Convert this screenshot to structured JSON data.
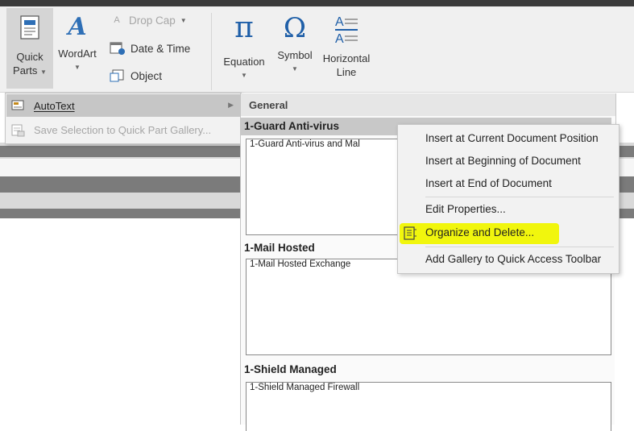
{
  "ribbon": {
    "quick_parts_line1": "Quick",
    "quick_parts_line2": "Parts",
    "wordart": "WordArt",
    "drop_cap": "Drop Cap",
    "date_time": "Date & Time",
    "object": "Object",
    "equation": "Equation",
    "symbol": "Symbol",
    "horizontal_line1": "Horizontal",
    "horizontal_line2": "Line"
  },
  "quick_parts_menu": {
    "autotext": "AutoText",
    "save_selection": "Save Selection to Quick Part Gallery..."
  },
  "gallery": {
    "section": "General",
    "entries": [
      {
        "title": "1-Guard Anti-virus",
        "preview": "1-Guard  Anti-virus and Mal"
      },
      {
        "title": "1-Mail Hosted",
        "preview": "1-Mail Hosted Exchange"
      },
      {
        "title": "1-Shield Managed",
        "preview": "1-Shield Managed  Firewall"
      }
    ]
  },
  "context_menu": {
    "items": [
      "Insert at Current Document Position",
      "Insert at Beginning of Document",
      "Insert at End of Document",
      "Edit Properties...",
      "Organize and Delete...",
      "Add Gallery to Quick Access Toolbar"
    ],
    "highlight_color": "#f0f500"
  },
  "icons": [
    "quick-parts-icon",
    "wordart-icon",
    "drop-cap-icon",
    "date-time-icon",
    "object-icon",
    "equation-icon",
    "symbol-icon",
    "horizontal-line-icon",
    "autotext-icon",
    "save-selection-icon",
    "organize-icon"
  ]
}
